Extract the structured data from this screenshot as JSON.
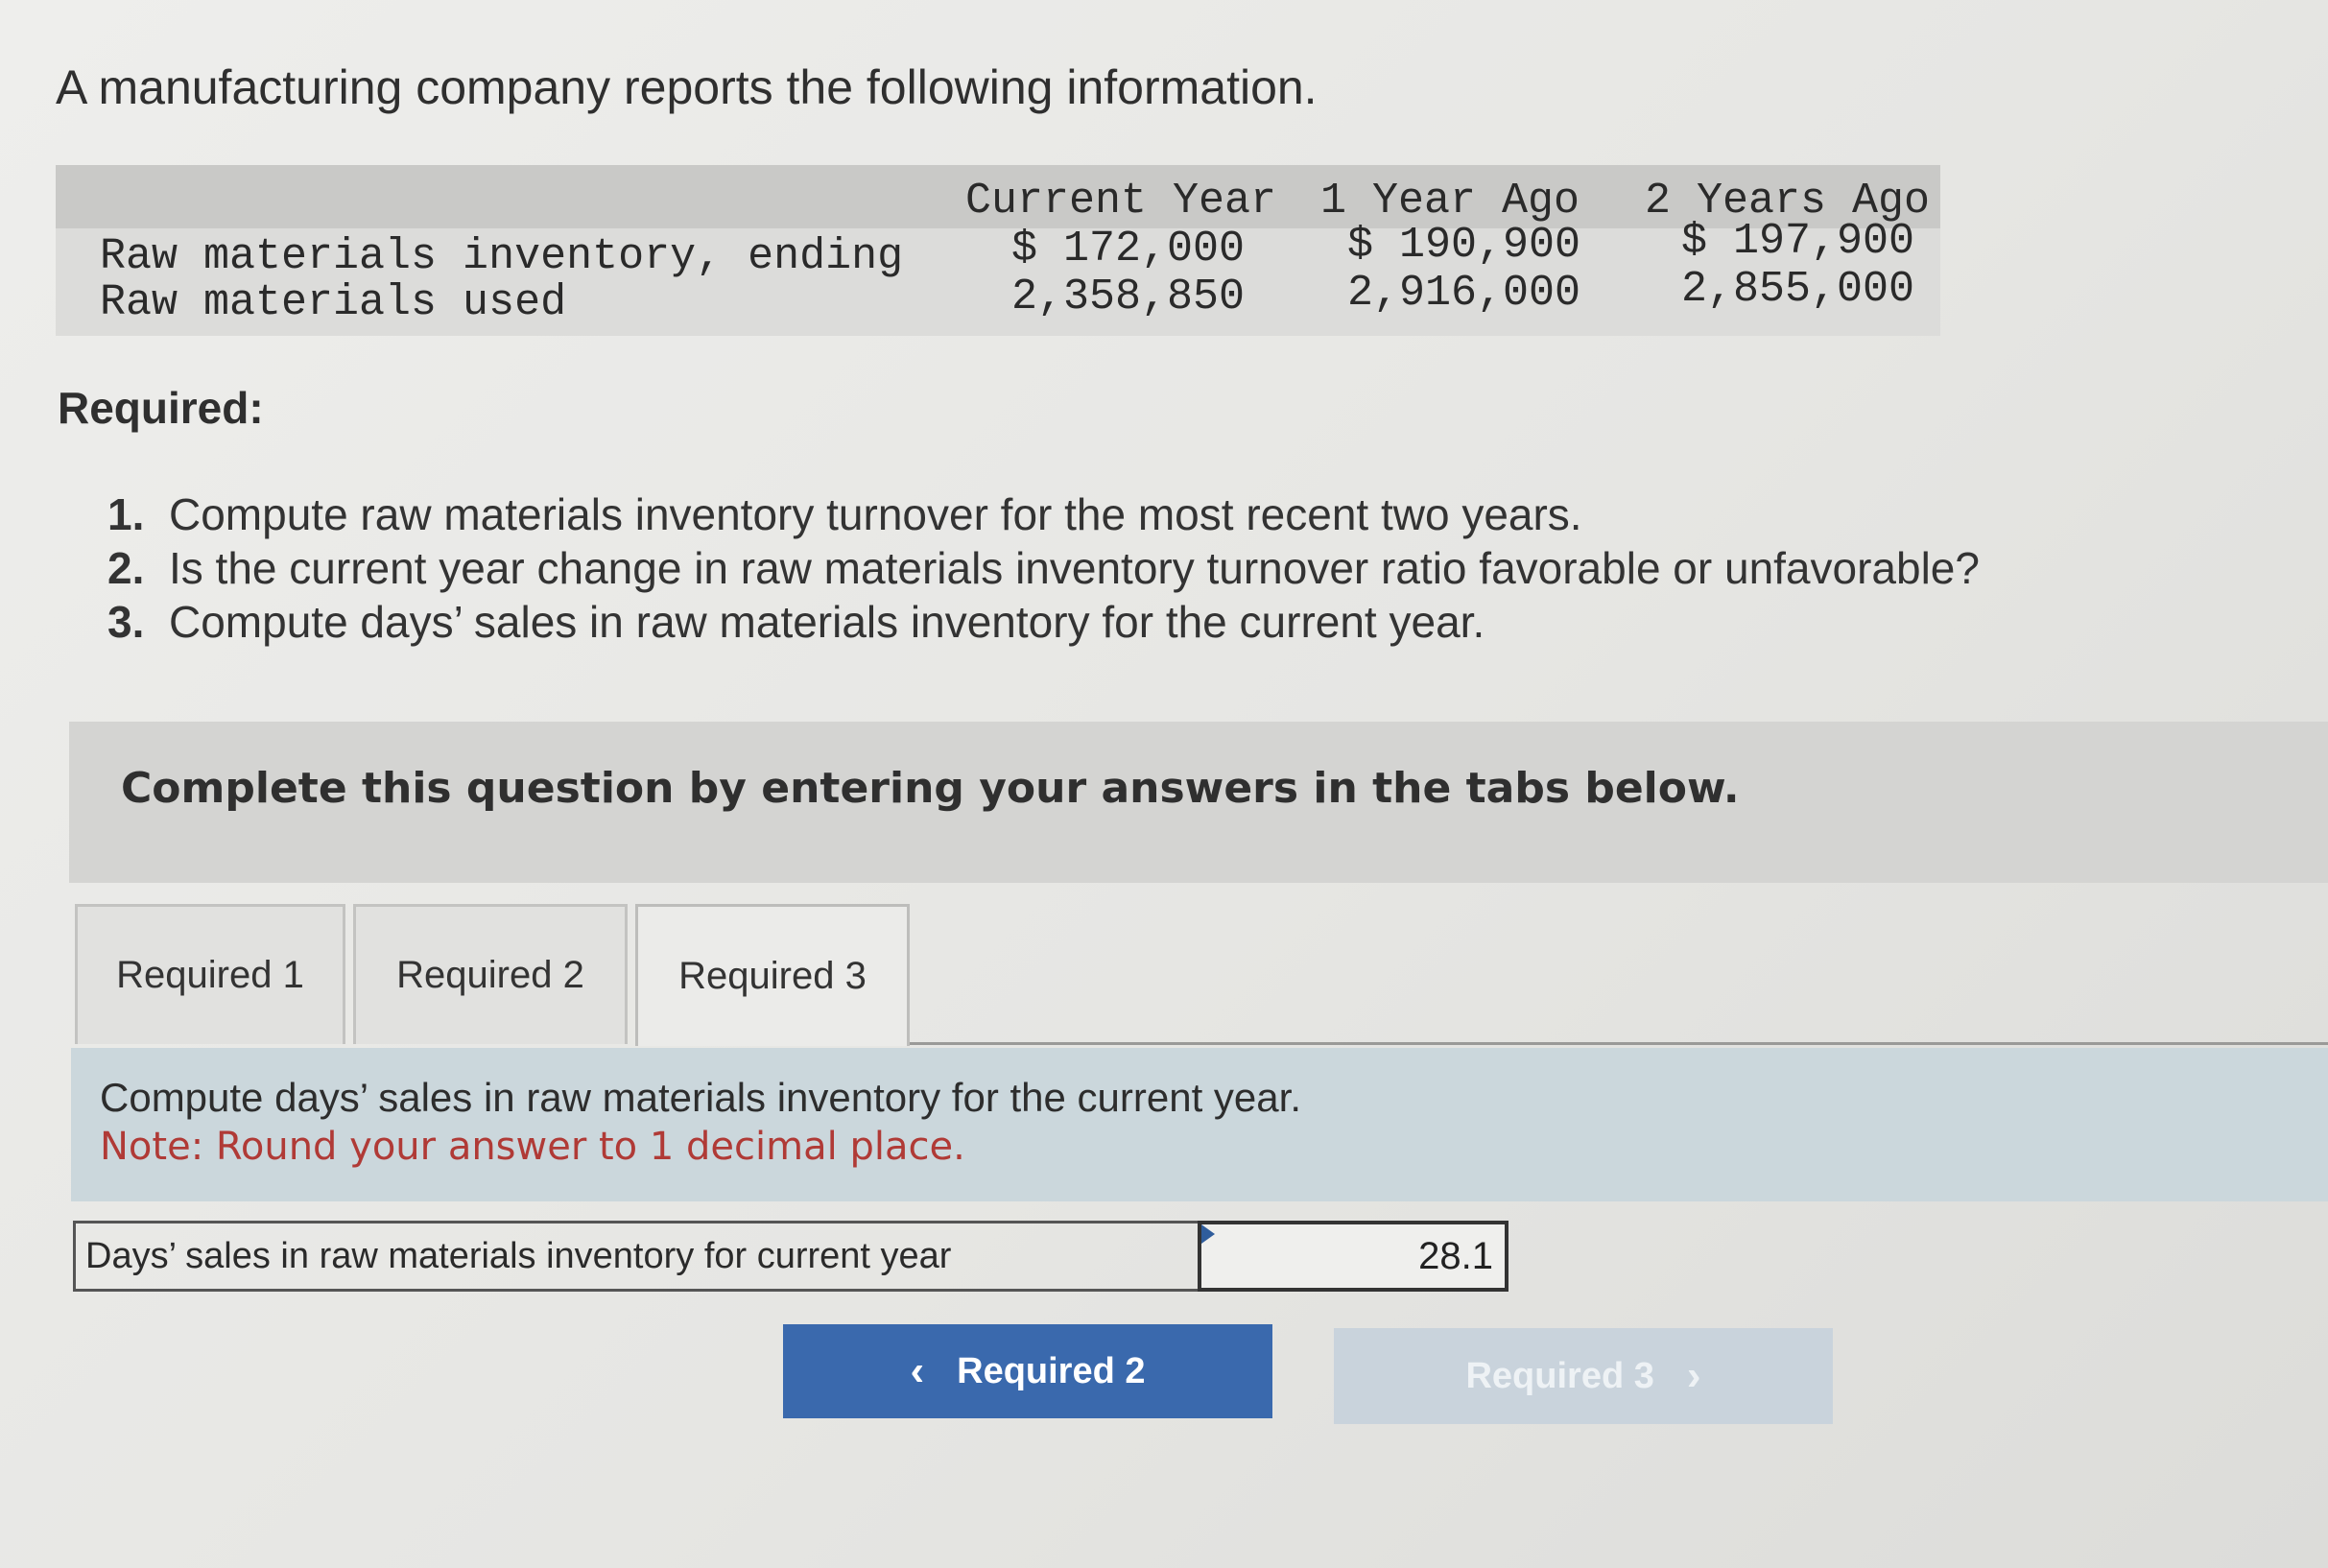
{
  "intro": "A manufacturing company reports the following information.",
  "table": {
    "columns": [
      "Current Year",
      "1 Year Ago",
      "2 Years Ago"
    ],
    "rows": [
      {
        "label": "Raw materials inventory, ending",
        "values": [
          "$ 172,000",
          "$ 190,900",
          "$ 197,900"
        ]
      },
      {
        "label": "Raw materials used",
        "values": [
          "2,358,850",
          "2,916,000",
          "2,855,000"
        ]
      }
    ]
  },
  "required_heading": "Required:",
  "requirements": [
    {
      "num": "1.",
      "text": "Compute raw materials inventory turnover for the most recent two years."
    },
    {
      "num": "2.",
      "text": "Is the current year change in raw materials inventory turnover ratio favorable or unfavorable?"
    },
    {
      "num": "3.",
      "text": "Compute days’ sales in raw materials inventory for the current year."
    }
  ],
  "instruction": "Complete this question by entering your answers in the tabs below.",
  "tabs": [
    "Required 1",
    "Required 2",
    "Required 3"
  ],
  "active_tab": "Required 3",
  "prompt": {
    "text": "Compute days’ sales in raw materials inventory for the current year.",
    "note": "Note: Round your answer to 1 decimal place."
  },
  "answer": {
    "label": "Days’ sales in raw materials inventory for current year",
    "value": "28.1"
  },
  "nav": {
    "prev_label": "Required 2",
    "next_label": "Required 3"
  }
}
